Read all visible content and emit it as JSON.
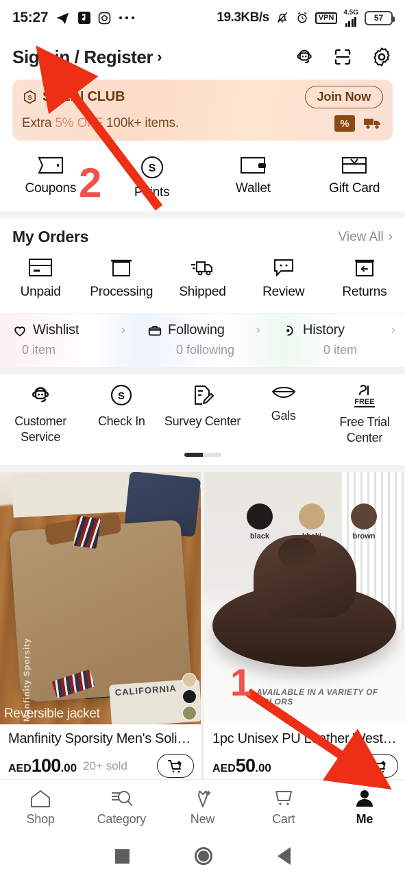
{
  "status_bar": {
    "time": "15:27",
    "left_icons": [
      "telegram-icon",
      "music-icon",
      "instagram-icon",
      "more-dots-icon"
    ],
    "network_speed": "19.3KB/s",
    "right_icons": [
      "bell-muted-icon",
      "alarm-icon"
    ],
    "vpn_label": "VPN",
    "network_type": "4.5G",
    "battery_level": "57"
  },
  "header": {
    "sign_in_label": "Sign in / Register",
    "chevron": "›",
    "icons": [
      "support-icon",
      "scan-icon",
      "settings-icon"
    ]
  },
  "club_banner": {
    "brand": "SHEIN CLUB",
    "brand_mark": "S",
    "join_label": "Join Now",
    "desc_prefix": "Extra ",
    "desc_highlight": "5% OFF",
    "desc_suffix": " 100k+ items.",
    "badges": [
      "percent-badge",
      "free-shipping-truck-icon"
    ]
  },
  "quick_links": [
    {
      "label": "Coupons",
      "icon": "coupon-icon"
    },
    {
      "label": "Points",
      "icon": "points-icon"
    },
    {
      "label": "Wallet",
      "icon": "wallet-icon"
    },
    {
      "label": "Gift Card",
      "icon": "gift-card-icon"
    }
  ],
  "my_orders": {
    "title": "My Orders",
    "view_all": "View All",
    "chevron": "›",
    "items": [
      {
        "label": "Unpaid",
        "icon": "unpaid-card-icon"
      },
      {
        "label": "Processing",
        "icon": "processing-box-icon"
      },
      {
        "label": "Shipped",
        "icon": "shipped-truck-icon"
      },
      {
        "label": "Review",
        "icon": "review-comment-icon"
      },
      {
        "label": "Returns",
        "icon": "returns-box-icon"
      }
    ]
  },
  "wish_row": [
    {
      "name": "Wishlist",
      "sub": "0 item",
      "icon": "heart-icon",
      "chevron": "›"
    },
    {
      "name": "Following",
      "sub": "0 following",
      "icon": "store-icon",
      "chevron": "›"
    },
    {
      "name": "History",
      "sub": "0 item",
      "icon": "history-icon",
      "chevron": "›"
    }
  ],
  "services": [
    {
      "label": "Customer\nService",
      "icon": "support-icon"
    },
    {
      "label": "Check In",
      "icon": "points-icon"
    },
    {
      "label": "Survey Center",
      "icon": "survey-icon"
    },
    {
      "label": "Gals",
      "icon": "lips-icon"
    },
    {
      "label": "Free Trial\nCenter",
      "icon": "free-trial-icon"
    }
  ],
  "products": [
    {
      "title": "Manfinity Sporsity Men's Solid ...",
      "currency": "AED",
      "price_main": "100",
      "price_cents": ".00",
      "sold": "20+ sold",
      "image_caption": "Reversible jacket",
      "image_brand": "Manfinity  Sporsity",
      "plate_text": "CALIFORNIA",
      "swatch_colors": [
        "#d9c5a2",
        "#1b1b1b",
        "#8c8f5e"
      ],
      "cart_icon": "add-to-cart-icon"
    },
    {
      "title": "1pc Unisex PU Leather Wester...",
      "currency": "AED",
      "price_main": "50",
      "price_cents": ".00",
      "sold": "",
      "image_note": "AVAILABLE IN A VARIETY OF COLORS",
      "color_chips": [
        {
          "label": "black",
          "color": "#1e1c1a"
        },
        {
          "label": "khaki",
          "color": "#c6a87c"
        },
        {
          "label": "brown",
          "color": "#5d453a"
        }
      ],
      "cart_icon": "add-to-cart-icon"
    }
  ],
  "bottom_nav": [
    {
      "label": "Shop",
      "icon": "home-icon",
      "active": false
    },
    {
      "label": "Category",
      "icon": "category-search-icon",
      "active": false
    },
    {
      "label": "New",
      "icon": "new-dress-icon",
      "active": false
    },
    {
      "label": "Cart",
      "icon": "cart-icon",
      "active": false
    },
    {
      "label": "Me",
      "icon": "person-icon",
      "active": true
    }
  ],
  "android_nav": [
    "recents-square-icon",
    "home-circle-icon",
    "back-triangle-icon"
  ],
  "annotations": [
    {
      "number": "1",
      "target": "add-to-cart-button-product-2"
    },
    {
      "number": "2",
      "target": "sign-in-register-link"
    }
  ],
  "colors": {
    "annotation_red": "#f0514b",
    "club_brown": "#6e3b14",
    "club_highlight": "#e08a6a"
  }
}
